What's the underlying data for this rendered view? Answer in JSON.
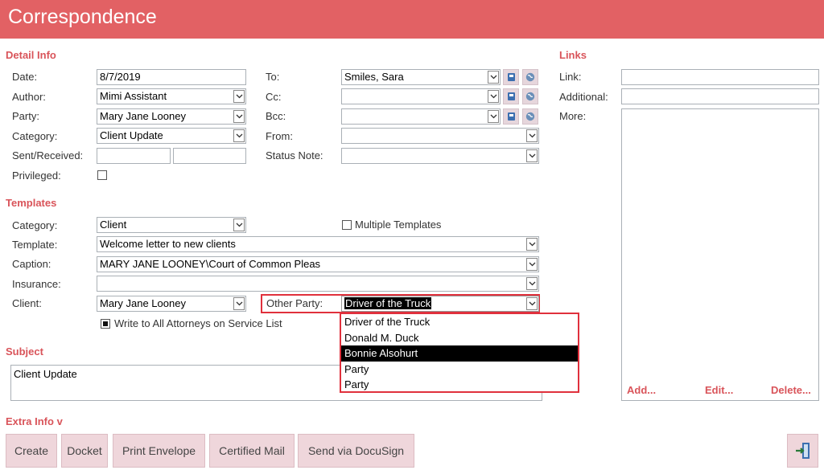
{
  "app": {
    "title": "Correspondence"
  },
  "detail": {
    "heading": "Detail Info",
    "date_label": "Date:",
    "date_value": "8/7/2019",
    "author_label": "Author:",
    "author_value": "Mimi Assistant",
    "party_label": "Party:",
    "party_value": "Mary  Jane Looney",
    "category_label": "Category:",
    "category_value": "Client Update",
    "sent_label": "Sent/Received:",
    "sent_value": "",
    "received_value": "",
    "privileged_label": "Privileged:",
    "privileged_checked": false,
    "to_label": "To:",
    "to_value": "Smiles, Sara",
    "cc_label": "Cc:",
    "cc_value": "",
    "bcc_label": "Bcc:",
    "bcc_value": "",
    "from_label": "From:",
    "from_value": "",
    "status_label": "Status Note:",
    "status_value": ""
  },
  "links": {
    "heading": "Links",
    "link_label": "Link:",
    "link_value": "",
    "additional_label": "Additional:",
    "additional_value": "",
    "more_label": "More:",
    "add_label": "Add...",
    "edit_label": "Edit...",
    "delete_label": "Delete..."
  },
  "templates": {
    "heading": "Templates",
    "category_label": "Category:",
    "category_value": "Client",
    "multiple_label": "Multiple Templates",
    "multiple_checked": false,
    "template_label": "Template:",
    "template_value": "Welcome letter to new clients",
    "caption_label": "Caption:",
    "caption_value": "MARY JANE LOONEY\\Court of Common Pleas",
    "insurance_label": "Insurance:",
    "insurance_value": "",
    "client_label": "Client:",
    "client_value": "Mary  Jane Looney",
    "other_party_label": "Other Party:",
    "other_party_value": "Driver of the Truck",
    "write_all_label": "Write to All Attorneys on Service List",
    "write_all_checked": true,
    "other_party_options": [
      "Driver of the Truck",
      "Donald M. Duck",
      "Bonnie Alsohurt",
      "Party",
      "Party"
    ],
    "other_party_highlighted_index": 2
  },
  "subject": {
    "heading": "Subject",
    "value": "Client Update"
  },
  "extra": {
    "label": "Extra Info v"
  },
  "actions": {
    "create": "Create",
    "docket": "Docket",
    "print_envelope": "Print Envelope",
    "certified_mail": "Certified Mail",
    "send_docusign": "Send via DocuSign"
  },
  "icons": {
    "address_book": "address-book-icon",
    "globe": "globe-icon",
    "exit": "exit-icon",
    "chevron": "chevron-down-icon"
  },
  "colors": {
    "accent": "#e26164",
    "section": "#d9545a",
    "button_bg": "#efd6db",
    "highlight_border": "#e0303c"
  }
}
